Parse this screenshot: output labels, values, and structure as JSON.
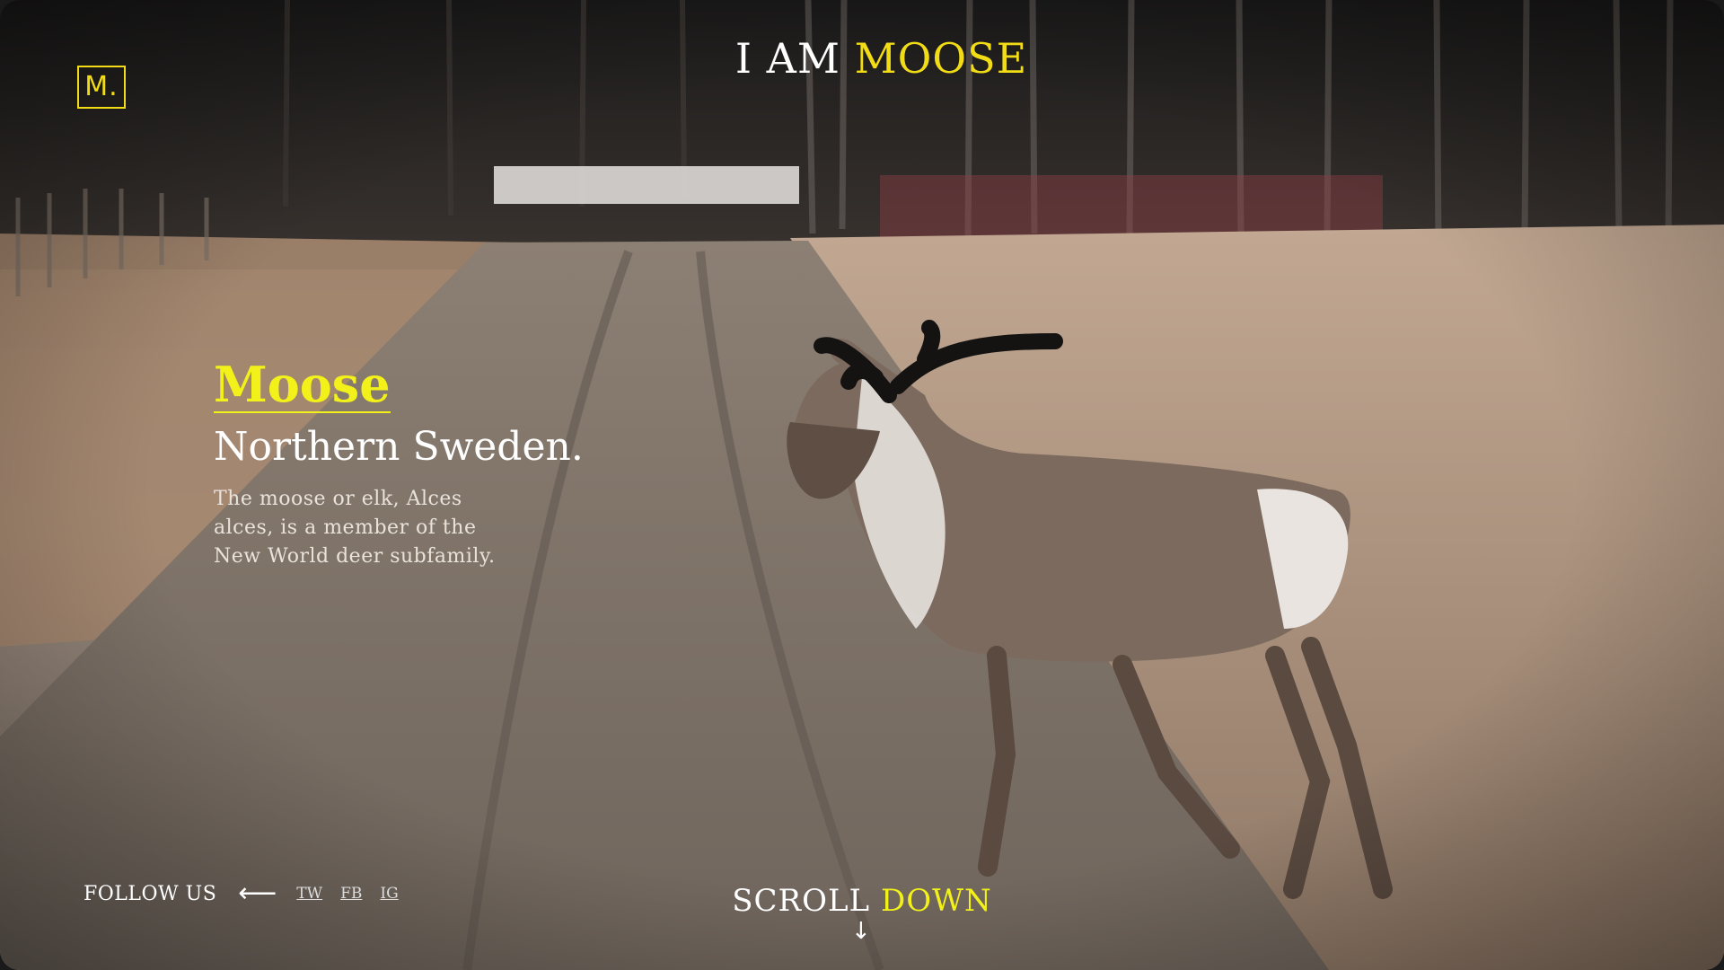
{
  "header": {
    "logo_text": "M.",
    "title_prefix": "I AM",
    "title_highlight": "MOOSE"
  },
  "intro": {
    "heading": "Moose",
    "subheading": "Northern Sweden.",
    "description": "The moose or elk, Alces alces, is a member of the New World deer subfamily."
  },
  "footer": {
    "follow_label": "FOLLOW US",
    "arrow_icon": "arrow-left-icon",
    "social_links": [
      "TW",
      "FB",
      "IG"
    ],
    "scroll_prefix": "SCROLL",
    "scroll_highlight": "DOWN",
    "scroll_icon": "arrow-down-icon"
  },
  "colors": {
    "accent": "#f2dc16",
    "heading_accent": "#f2f21a",
    "text": "#ffffff"
  }
}
